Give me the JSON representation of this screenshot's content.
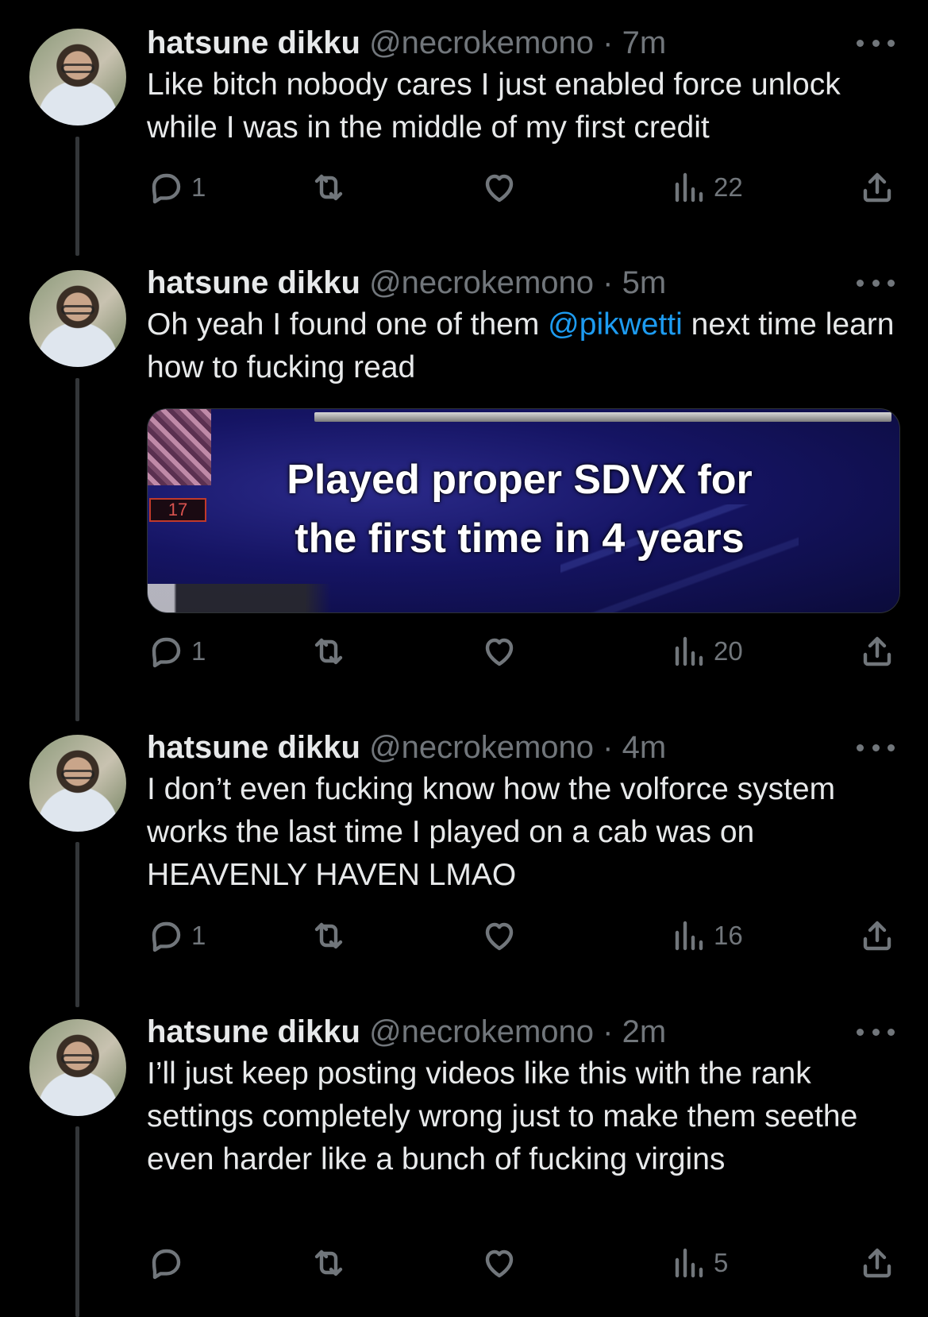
{
  "tweets": [
    {
      "name": "hatsune dikku",
      "handle": "@necrokemono",
      "sep": " · ",
      "time": "7m",
      "text": "Like bitch nobody cares I just enabled force unlock while I was in the middle of my first credit",
      "replies": "1",
      "views": "22"
    },
    {
      "name": "hatsune dikku",
      "handle": "@necrokemono",
      "sep": " · ",
      "time": "5m",
      "text_before": "Oh yeah I found one of them ",
      "mention": "@pikwetti",
      "text_after": " next time learn how to fucking read",
      "media": {
        "caption_line1": "Played proper SDVX for",
        "caption_line2": "the first time in 4 years",
        "level": "17"
      },
      "replies": "1",
      "views": "20"
    },
    {
      "name": "hatsune dikku",
      "handle": "@necrokemono",
      "sep": " · ",
      "time": "4m",
      "text": "I don’t even fucking know how the volforce system works the last time I played on a cab was on HEAVENLY HAVEN LMAO",
      "replies": "1",
      "views": "16"
    },
    {
      "name": "hatsune dikku",
      "handle": "@necrokemono",
      "sep": " · ",
      "time": "2m",
      "text": "I’ll just keep posting videos like this with the rank settings completely wrong just to make them seethe even harder like a bunch of fucking virgins",
      "replies": "",
      "views": "5"
    }
  ],
  "icons": {
    "reply": "reply-icon",
    "retweet": "retweet-icon",
    "like": "heart-icon",
    "views": "views-icon",
    "share": "share-icon",
    "more": "more-icon"
  },
  "colors": {
    "background": "#000000",
    "text": "#e7e9ea",
    "secondary": "#71767b",
    "link": "#1d9bf0"
  }
}
